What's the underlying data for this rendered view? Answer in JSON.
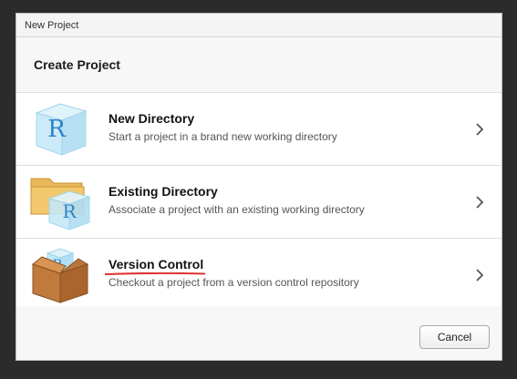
{
  "window": {
    "title": "New Project"
  },
  "header": {
    "title": "Create Project"
  },
  "options": [
    {
      "title": "New Directory",
      "description": "Start a project in a brand new working directory",
      "icon": "r-cube-icon"
    },
    {
      "title": "Existing Directory",
      "description": "Associate a project with an existing working directory",
      "icon": "folder-r-cube-icon"
    },
    {
      "title": "Version Control",
      "description": "Checkout a project from a version control repository",
      "icon": "box-r-cube-icon"
    }
  ],
  "footer": {
    "cancel_label": "Cancel"
  },
  "colors": {
    "annotation_underline": "#e03030",
    "r_letter": "#2f80c8",
    "cube_fill": "#bfe6f5"
  }
}
